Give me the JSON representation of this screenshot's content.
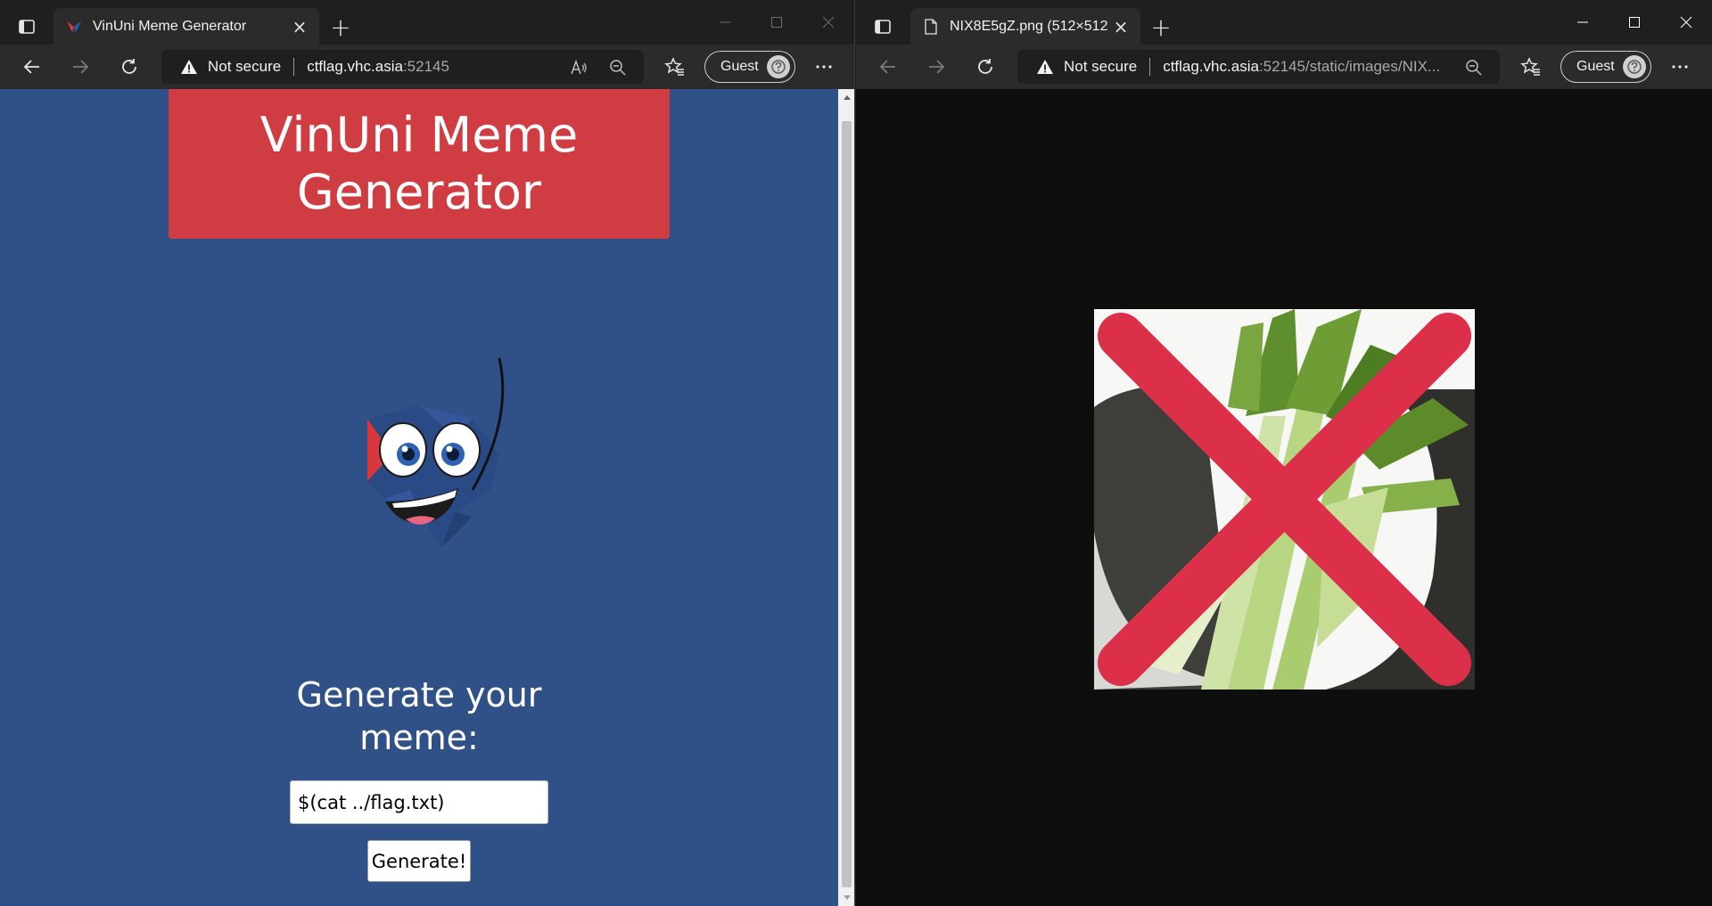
{
  "left_window": {
    "tab": {
      "title": "VinUni Meme Generator",
      "close": "×"
    },
    "new_tab": "+",
    "address": {
      "not_secure": "Not secure",
      "host": "ctflag.vhc.asia",
      "rest": ":52145"
    },
    "guest": {
      "label": "Guest"
    },
    "page": {
      "header_title": "VinUni Meme Generator",
      "generate_title": "Generate your meme:",
      "meme_input_value": "$(cat ../flag.txt)",
      "generate_button": "Generate!"
    },
    "colors": {
      "page_bg": "#2f5187",
      "header_bg": "#cf3c42"
    }
  },
  "right_window": {
    "tab": {
      "title": "NIX8E5gZ.png (512×512)",
      "close": "×"
    },
    "new_tab": "+",
    "address": {
      "not_secure": "Not secure",
      "host": "ctflag.vhc.asia",
      "rest": ":52145/static/images/NIX..."
    },
    "guest": {
      "label": "Guest"
    },
    "image": {
      "icon": "crossed-out-leek-image"
    }
  }
}
